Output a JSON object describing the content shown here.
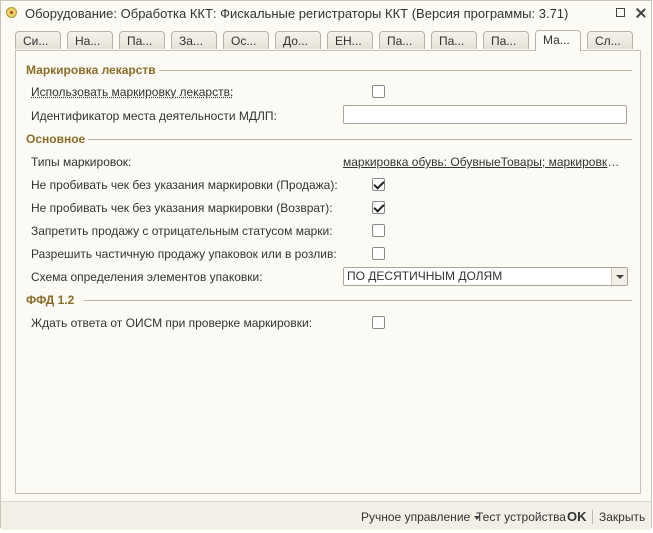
{
  "window": {
    "title": "Оборудование: Обработка ККТ: Фискальные регистраторы ККТ (Версия программы: 3.71)"
  },
  "tabs": [
    "Си...",
    "На...",
    "Па...",
    "За...",
    "Ос...",
    "До...",
    "ЕН...",
    "Па...",
    "Па...",
    "Па...",
    "Ма...",
    "Сл..."
  ],
  "active_tab": 10,
  "sections": {
    "medicines": {
      "title": "Маркировка лекарств",
      "use_label": "Использовать маркировку лекарств:",
      "use_checked": false,
      "mdlp_label": "Идентификатор места деятельности МДЛП:",
      "mdlp_value": ""
    },
    "main": {
      "title": "Основное",
      "types_label": "Типы маркировок:",
      "types_value": "маркировка обувь: ОбувныеТовары; маркировка оде...",
      "no_sale_label": "Не пробивать чек без указания маркировки (Продажа):",
      "no_sale_checked": true,
      "no_return_label": "Не пробивать чек без указания маркировки (Возврат):",
      "no_return_checked": true,
      "forbid_neg_label": "Запретить продажу с отрицательным статусом марки:",
      "forbid_neg_checked": false,
      "partial_label": "Разрешить частичную продажу упаковок или в розлив:",
      "partial_checked": false,
      "scheme_label": "Схема определения элементов упаковки:",
      "scheme_value": "ПО ДЕСЯТИЧНЫМ ДОЛЯМ"
    },
    "ffd": {
      "title": "ФФД 1.2",
      "wait_label": "Ждать ответа от ОИСМ при проверке маркировки:",
      "wait_checked": false
    }
  },
  "footer": {
    "manual": "Ручное управление",
    "test": "Тест устройства",
    "ok": "OK",
    "close": "Закрыть"
  }
}
